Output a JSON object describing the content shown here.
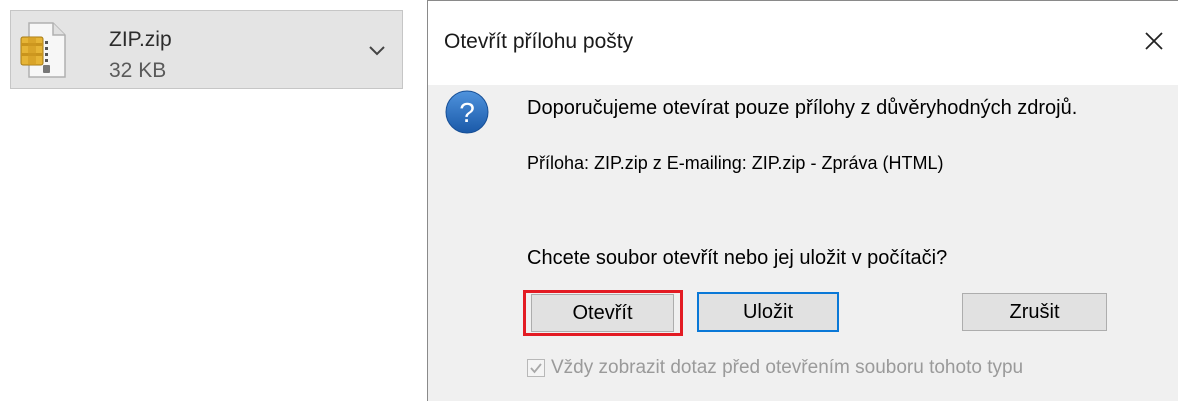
{
  "attachment": {
    "file_name": "ZIP.zip",
    "file_size": "32 KB",
    "icon": "zip-archive-icon",
    "menu_icon": "chevron-down-icon"
  },
  "dialog": {
    "title": "Otevřít přílohu pošty",
    "close_icon": "close-icon",
    "info_icon": "question-icon",
    "message": "Doporučujeme otevírat pouze přílohy z důvěryhodných zdrojů.",
    "detail": "Příloha: ZIP.zip z E-mailing: ZIP.zip  - Zpráva (HTML)",
    "question": "Chcete soubor otevřít nebo jej uložit v počítači?",
    "buttons": {
      "open": "Otevřít",
      "save": "Uložit",
      "cancel": "Zrušit"
    },
    "checkbox": {
      "label": "Vždy zobrazit dotaz před otevřením souboru tohoto typu",
      "checked": true,
      "disabled": true
    }
  },
  "colors": {
    "highlight": "#e31b23",
    "focus": "#0a78d7",
    "question_icon": "#1f64b5"
  }
}
